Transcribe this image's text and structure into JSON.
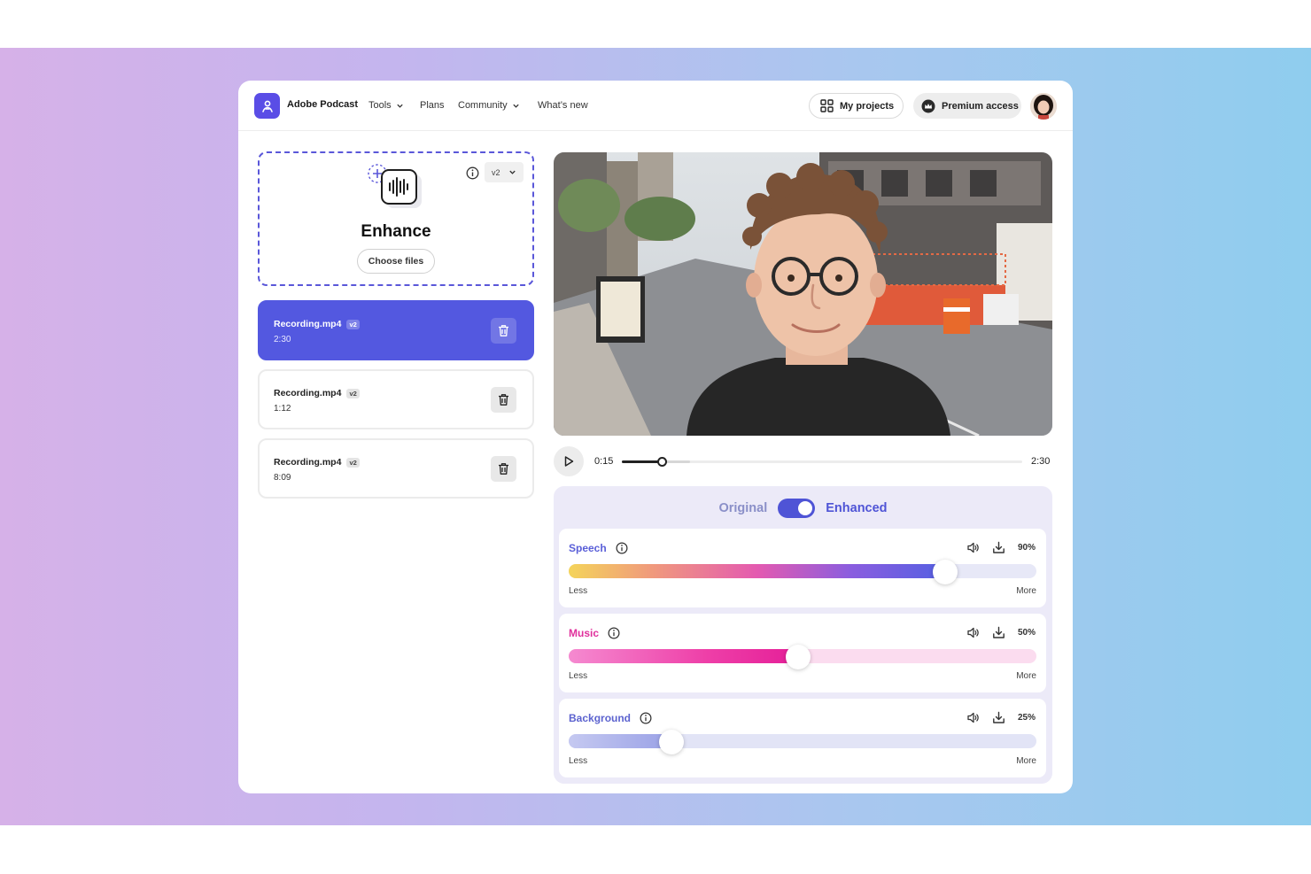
{
  "header": {
    "brand": "Adobe Podcast",
    "nav": [
      {
        "label": "Tools",
        "dropdown": true
      },
      {
        "label": "Plans",
        "dropdown": false
      },
      {
        "label": "Community",
        "dropdown": true
      },
      {
        "label": "What’s new",
        "dropdown": false
      }
    ],
    "my_projects": "My projects",
    "premium": "Premium access"
  },
  "enhance": {
    "title": "Enhance",
    "choose_files": "Choose files",
    "version": "v2"
  },
  "files": [
    {
      "name": "Recording.mp4",
      "badge": "v2",
      "duration": "2:30",
      "active": true
    },
    {
      "name": "Recording.mp4",
      "badge": "v2",
      "duration": "1:12",
      "active": false
    },
    {
      "name": "Recording.mp4",
      "badge": "v2",
      "duration": "8:09",
      "active": false
    }
  ],
  "player": {
    "current": "0:15",
    "total": "2:30",
    "progress": 0.1,
    "buffered": 0.17
  },
  "mix": {
    "original_label": "Original",
    "enhanced_label": "Enhanced",
    "enhanced_on": true,
    "less_label": "Less",
    "more_label": "More",
    "sliders": [
      {
        "name": "Speech",
        "percent": "90%",
        "value": 0.805,
        "color": "#5a5fd8"
      },
      {
        "name": "Music",
        "percent": "50%",
        "value": 0.49,
        "color": "#e0309c"
      },
      {
        "name": "Background",
        "percent": "25%",
        "value": 0.22,
        "color": "#5c63cf"
      }
    ]
  },
  "colors": {
    "accent": "#5358e0",
    "enhanced_toggle": "#4f54d6"
  }
}
